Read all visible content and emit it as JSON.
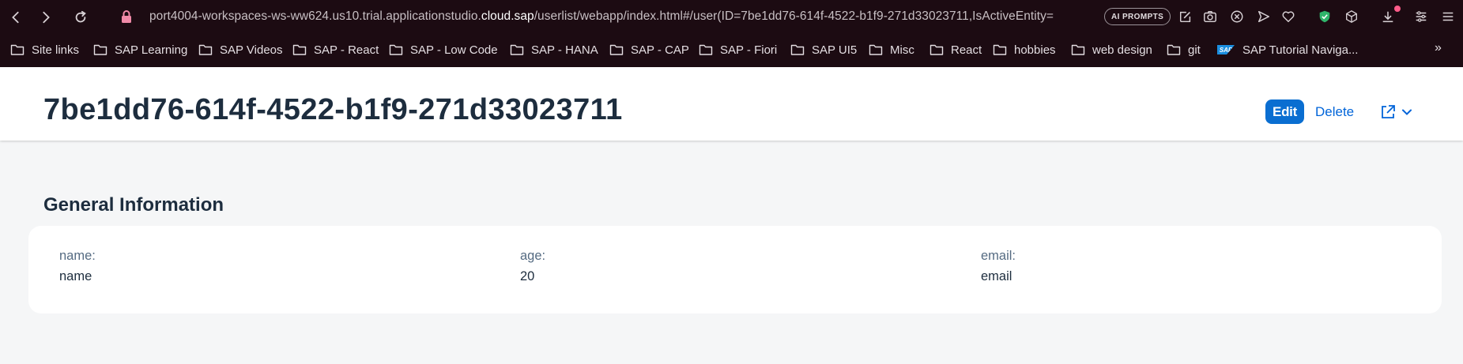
{
  "browser": {
    "url_prefix": "port4004-workspaces-ws-ww624.us10.trial.applicationstudio.",
    "url_domain": "cloud.sap",
    "url_suffix": "/userlist/webapp/index.html#/user(ID=7be1dd76-614f-4522-b1f9-271d33023711,IsActiveEntity=",
    "ai_prompts_label": "AI PROMPTS",
    "bookmarks": [
      {
        "label": "Site links",
        "icon": "folder-icon"
      },
      {
        "label": "SAP Learning",
        "icon": "folder-icon"
      },
      {
        "label": "SAP Videos",
        "icon": "folder-icon"
      },
      {
        "label": "SAP - React",
        "icon": "folder-icon"
      },
      {
        "label": "SAP - Low Code",
        "icon": "folder-icon"
      },
      {
        "label": "SAP - HANA",
        "icon": "folder-icon"
      },
      {
        "label": "SAP - CAP",
        "icon": "folder-icon"
      },
      {
        "label": "SAP - Fiori",
        "icon": "folder-icon"
      },
      {
        "label": "SAP UI5",
        "icon": "folder-icon"
      },
      {
        "label": "Misc",
        "icon": "folder-icon"
      },
      {
        "label": "React",
        "icon": "folder-icon"
      },
      {
        "label": "hobbies",
        "icon": "folder-icon"
      },
      {
        "label": "web design",
        "icon": "folder-icon"
      },
      {
        "label": "git",
        "icon": "folder-icon"
      },
      {
        "label": "SAP Tutorial Naviga...",
        "icon": "sap-logo-icon"
      }
    ],
    "more_bookmarks": "»"
  },
  "header": {
    "title": "7be1dd76-614f-4522-b1f9-271d33023711",
    "edit_label": "Edit",
    "delete_label": "Delete"
  },
  "section": {
    "title": "General Information",
    "fields": [
      {
        "label": "name:",
        "value": "name"
      },
      {
        "label": "age:",
        "value": "20"
      },
      {
        "label": "email:",
        "value": "email"
      }
    ]
  },
  "colors": {
    "accent": "#0a6ed1",
    "link": "#0064d9",
    "browser_bg": "#1c0b12",
    "page_bg": "#f5f6f7"
  }
}
